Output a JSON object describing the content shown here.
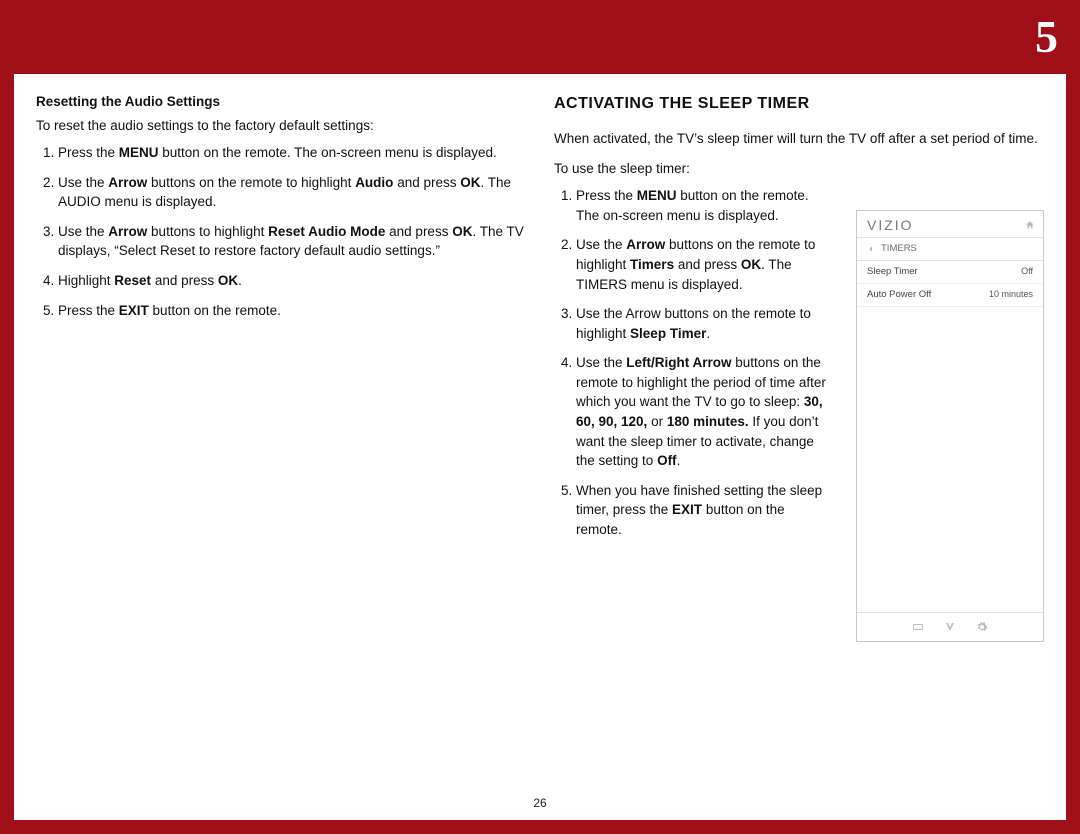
{
  "chapter_number": "5",
  "page_number": "26",
  "left": {
    "subhead": "Resetting the Audio Settings",
    "intro": "To reset the audio settings to the factory default settings:",
    "steps": {
      "s1a": "Press the ",
      "s1b": "MENU",
      "s1c": " button on the remote. The on-screen menu is displayed.",
      "s2a": "Use the ",
      "s2b": "Arrow",
      "s2c": " buttons on the remote to highlight ",
      "s2d": "Audio",
      "s2e": " and press ",
      "s2f": "OK",
      "s2g": ". The AUDIO menu is displayed.",
      "s3a": "Use the ",
      "s3b": "Arrow",
      "s3c": " buttons to highlight ",
      "s3d": "Reset Audio Mode",
      "s3e": " and press ",
      "s3f": "OK",
      "s3g": ". The TV displays, “Select Reset to restore factory default audio settings.”",
      "s4a": "Highlight ",
      "s4b": "Reset",
      "s4c": " and press ",
      "s4d": "OK",
      "s4e": ".",
      "s5a": "Press the ",
      "s5b": "EXIT",
      "s5c": " button on the remote."
    }
  },
  "right": {
    "title": "ACTIVATING THE  SLEEP TIMER",
    "p1": "When activated, the TV’s sleep timer will turn the TV off after a set period of time.",
    "p2": "To use the sleep timer:",
    "steps": {
      "s1a": "Press the ",
      "s1b": "MENU",
      "s1c": " button on the remote. The on-screen menu is displayed.",
      "s2a": "Use the ",
      "s2b": "Arrow",
      "s2c": " buttons on the remote to highlight ",
      "s2d": "Timers",
      "s2e": " and press ",
      "s2f": "OK",
      "s2g": ". The TIMERS menu is displayed.",
      "s3a": "Use the Arrow buttons on the remote to highlight ",
      "s3b": "Sleep Timer",
      "s3c": ".",
      "s4a": "Use the ",
      "s4b": "Left/Right Arrow",
      "s4c": " buttons on the remote to highlight the period of time after which you want the TV to go to sleep: ",
      "s4d": "30, 60, 90, 120,",
      "s4e": " or ",
      "s4f": "180 minutes.",
      "s4g": " If you don’t want the sleep timer to activate, change the setting to ",
      "s4h": "Off",
      "s4i": ".",
      "s5a": "When you have finished setting the sleep timer, press the ",
      "s5b": "EXIT",
      "s5c": " button on the remote."
    }
  },
  "menu": {
    "brand": "VIZIO",
    "title": "TIMERS",
    "rows": {
      "r1_label": "Sleep Timer",
      "r1_value": "Off",
      "r2_label": "Auto Power Off",
      "r2_value": "10 minutes"
    }
  }
}
